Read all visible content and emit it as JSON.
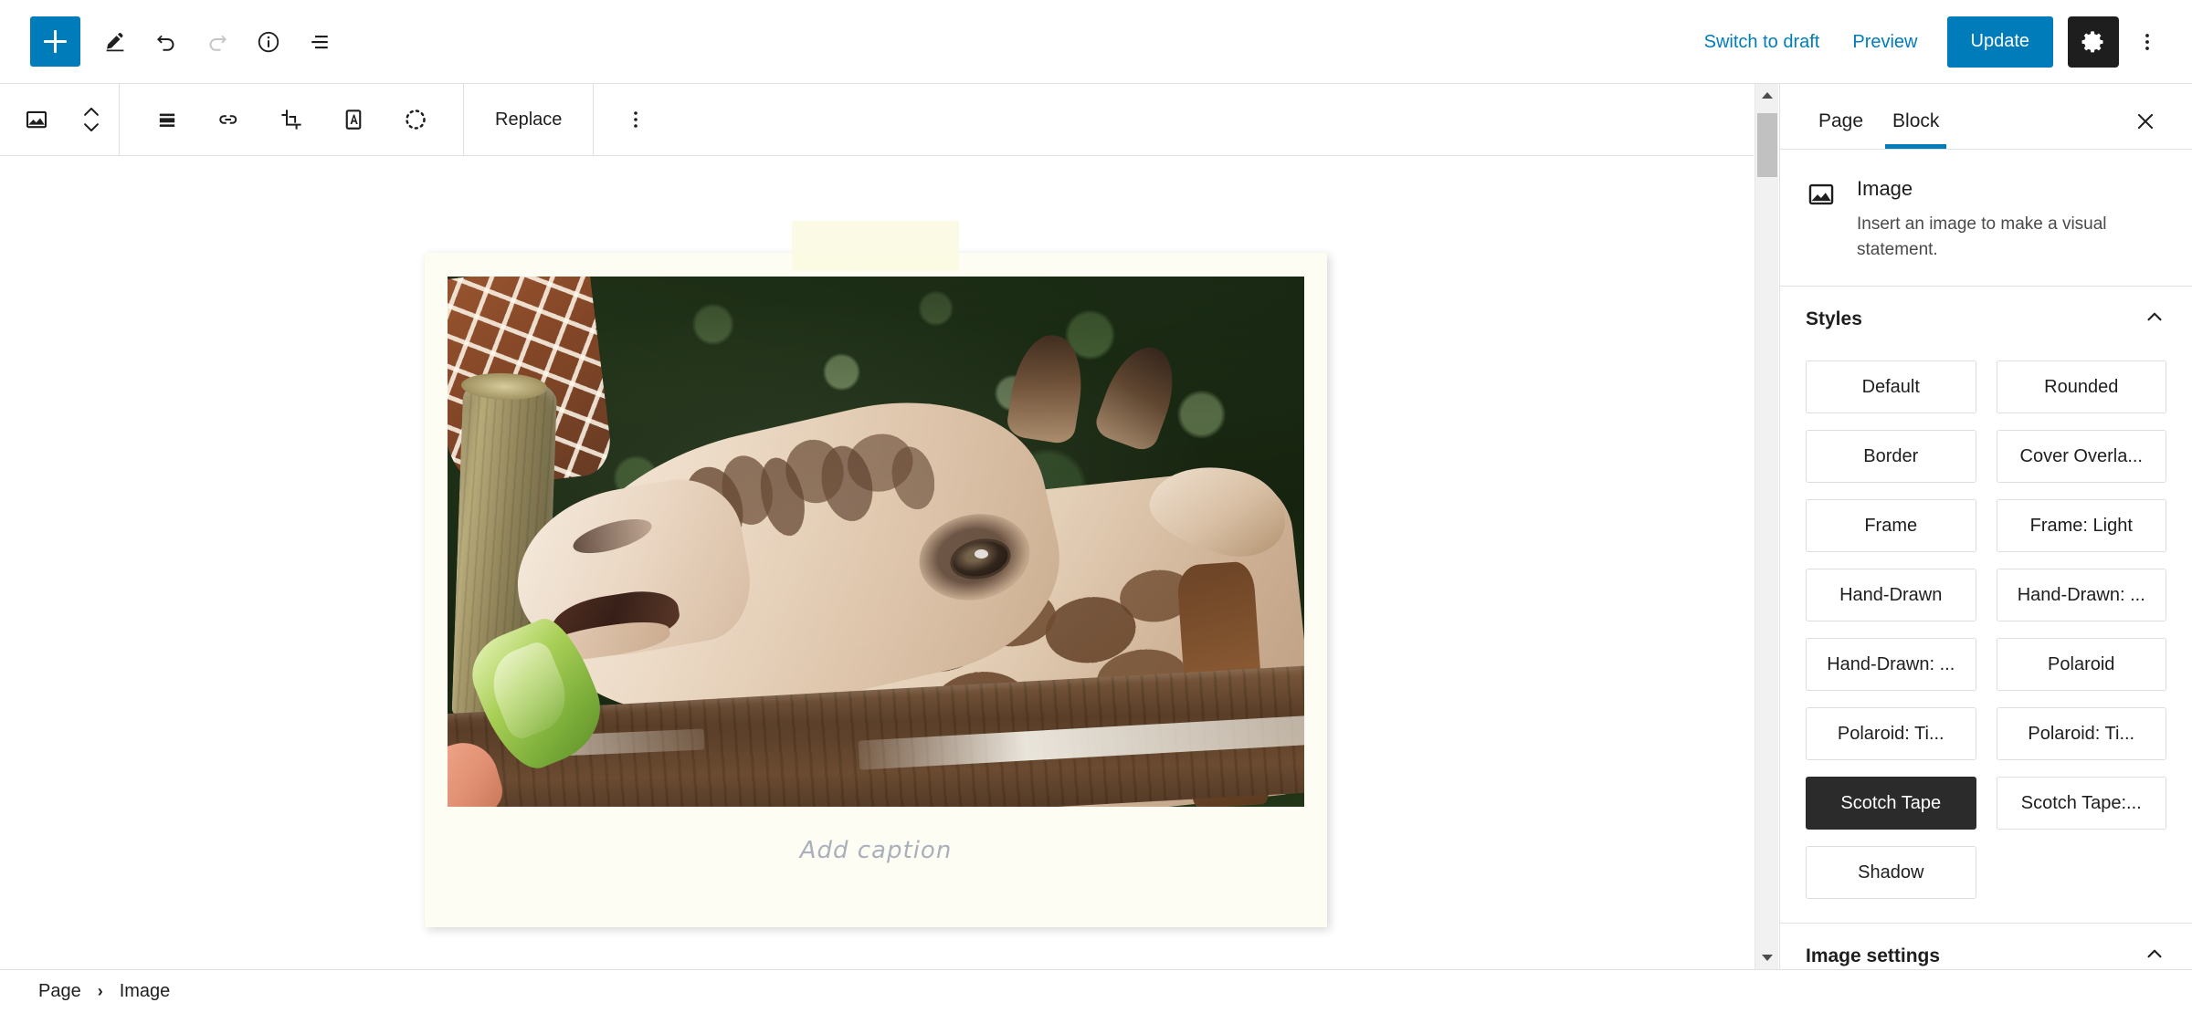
{
  "header": {
    "add_block_tooltip": "Add block",
    "tools": [
      {
        "name": "add-block-button",
        "label": "Add block"
      },
      {
        "name": "edit-tool-button",
        "label": "Tools"
      },
      {
        "name": "undo-button",
        "label": "Undo"
      },
      {
        "name": "redo-button",
        "label": "Redo"
      },
      {
        "name": "details-button",
        "label": "Details"
      },
      {
        "name": "list-view-button",
        "label": "List View"
      }
    ],
    "switch_to_draft": "Switch to draft",
    "preview": "Preview",
    "update": "Update",
    "settings_label": "Settings",
    "options_label": "Options",
    "accent_color": "#007cba",
    "dark_color": "#1e1e1e"
  },
  "block_toolbar": {
    "block_type_label": "Image",
    "move_label": "Move up or down",
    "align_label": "Align",
    "link_label": "Link",
    "crop_label": "Crop",
    "text_over_image_label": "Text over image",
    "filter_label": "Duotone",
    "replace": "Replace",
    "options_label": "Options"
  },
  "canvas": {
    "image_block": {
      "style_applied": "Scotch Tape",
      "caption_placeholder": "Add caption",
      "alt_description": "Giraffe eating a lettuce leaf over a wooden fence rail at a zoo",
      "frame_color": "#fdfdf4",
      "tape_color": "#fafae1"
    }
  },
  "sidebar": {
    "tabs": [
      {
        "label": "Page",
        "active": false
      },
      {
        "label": "Block",
        "active": true
      }
    ],
    "close_label": "Close settings",
    "block_card": {
      "icon": "image-icon",
      "title": "Image",
      "description": "Insert an image to make a visual statement."
    },
    "styles_panel": {
      "title": "Styles",
      "expanded": true,
      "options": [
        {
          "label": "Default",
          "selected": false
        },
        {
          "label": "Rounded",
          "selected": false
        },
        {
          "label": "Border",
          "selected": false
        },
        {
          "label": "Cover Overla...",
          "selected": false
        },
        {
          "label": "Frame",
          "selected": false
        },
        {
          "label": "Frame: Light",
          "selected": false
        },
        {
          "label": "Hand-Drawn",
          "selected": false
        },
        {
          "label": "Hand-Drawn: ...",
          "selected": false
        },
        {
          "label": "Hand-Drawn: ...",
          "selected": false
        },
        {
          "label": "Polaroid",
          "selected": false
        },
        {
          "label": "Polaroid: Ti...",
          "selected": false
        },
        {
          "label": "Polaroid: Ti...",
          "selected": false
        },
        {
          "label": "Scotch Tape",
          "selected": true
        },
        {
          "label": "Scotch Tape:...",
          "selected": false
        },
        {
          "label": "Shadow",
          "selected": false
        }
      ]
    },
    "image_settings_panel": {
      "title": "Image settings",
      "expanded": true
    }
  },
  "footer": {
    "breadcrumb": [
      {
        "label": "Page"
      },
      {
        "label": "Image"
      }
    ],
    "separator": "›"
  },
  "scrollbar": {
    "up_label": "Scroll up",
    "down_label": "Scroll down",
    "thumb_label": "Scroll thumb"
  }
}
